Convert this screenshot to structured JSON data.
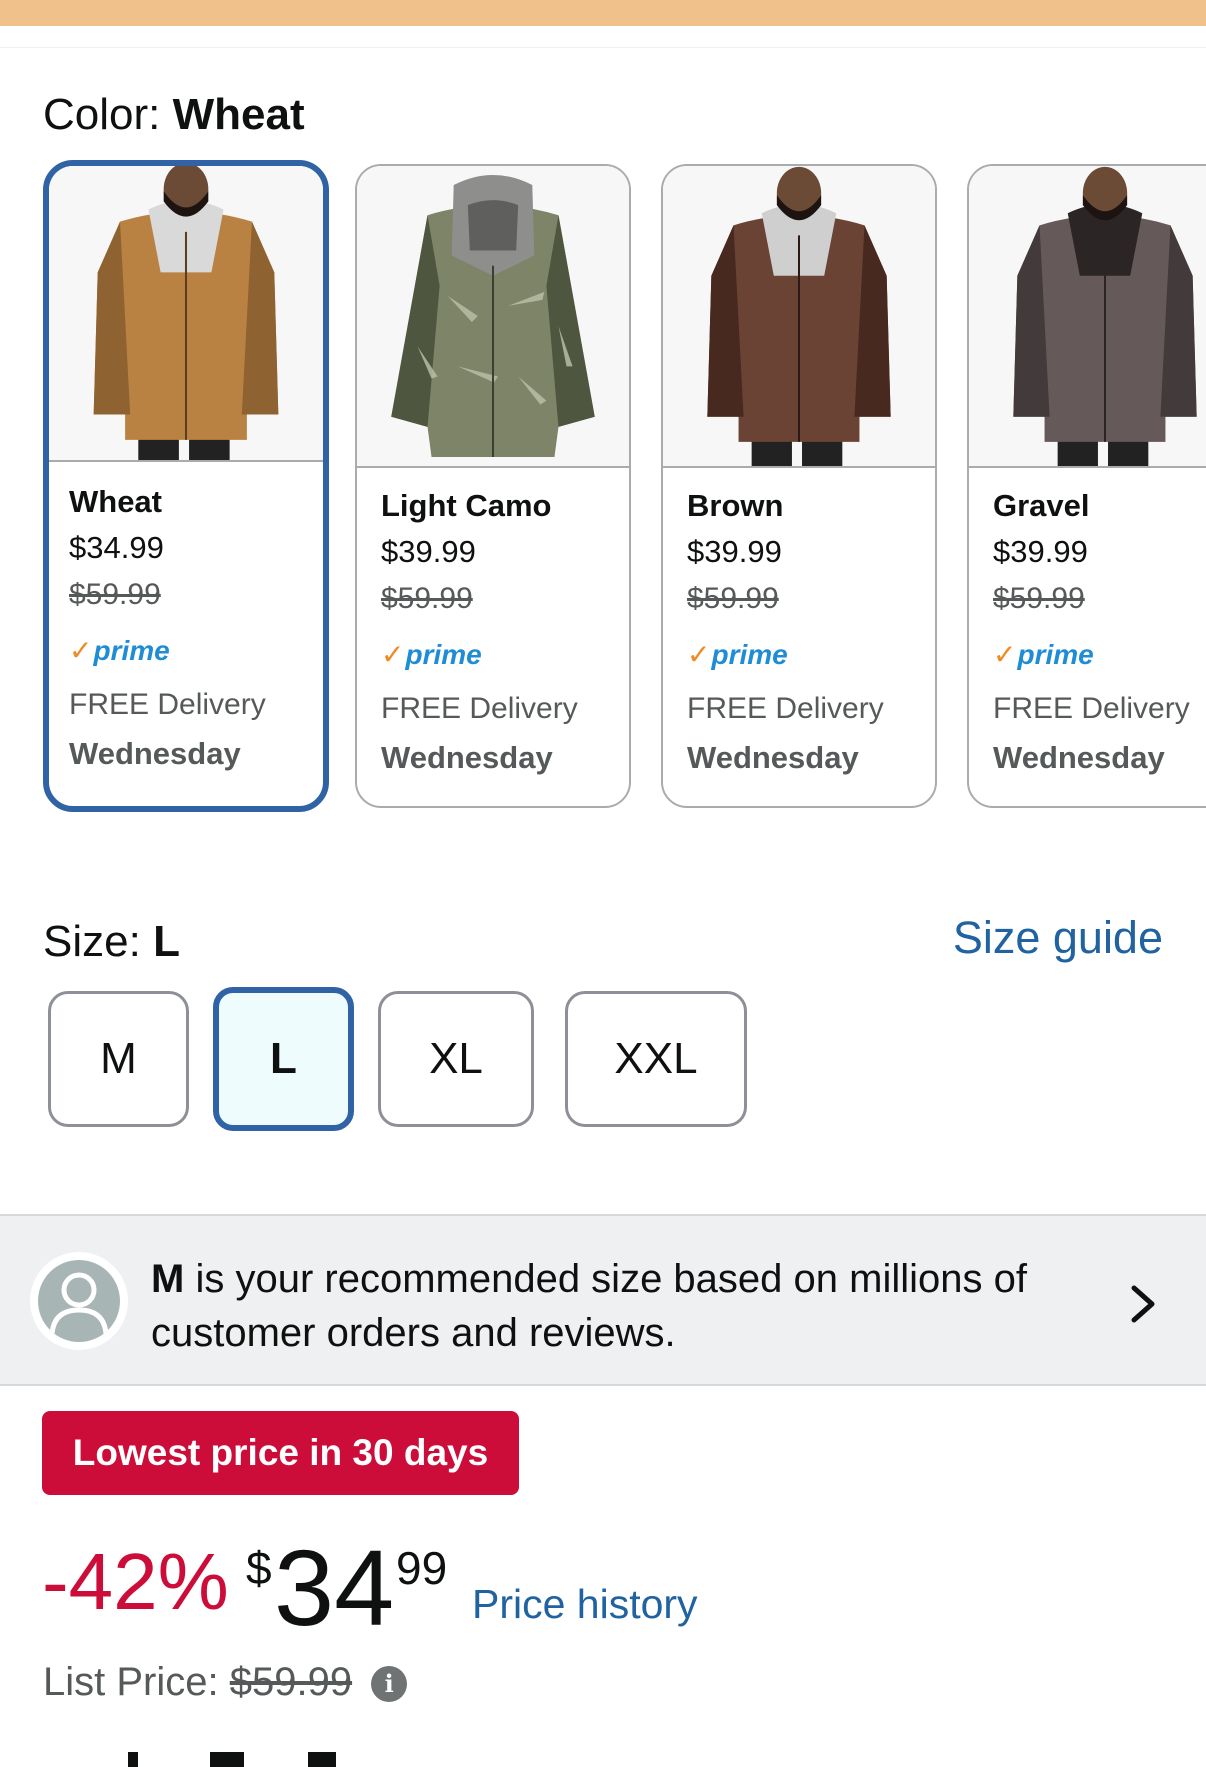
{
  "color_section": {
    "label": "Color:",
    "selected": "Wheat",
    "options": [
      {
        "name": "Wheat",
        "price": "$34.99",
        "list_price": "$59.99",
        "prime": "prime",
        "delivery": "FREE Delivery",
        "day": "Wednesday",
        "jacket_color": "#b98243",
        "shade_color": "#8f6231"
      },
      {
        "name": "Light Camo",
        "price": "$39.99",
        "list_price": "$59.99",
        "prime": "prime",
        "delivery": "FREE Delivery",
        "day": "Wednesday",
        "jacket_color": "#7d8468",
        "shade_color": "#4f5640"
      },
      {
        "name": "Brown",
        "price": "$39.99",
        "list_price": "$59.99",
        "prime": "prime",
        "delivery": "FREE Delivery",
        "day": "Wednesday",
        "jacket_color": "#6a4335",
        "shade_color": "#47291f"
      },
      {
        "name": "Gravel",
        "price": "$39.99",
        "list_price": "$59.99",
        "prime": "prime",
        "delivery": "FREE Delivery",
        "day": "Wednesday",
        "jacket_color": "#65595a",
        "shade_color": "#433a3b"
      }
    ]
  },
  "size_section": {
    "label": "Size:",
    "selected": "L",
    "guide_link": "Size guide",
    "options": [
      "M",
      "L",
      "XL",
      "XXL"
    ]
  },
  "recommendation": {
    "size": "M",
    "text": "is your recommended size based on millions of customer orders and reviews."
  },
  "deal_badge": "Lowest price in 30 days",
  "price": {
    "discount": "-42%",
    "currency": "$",
    "whole": "34",
    "fraction": "99",
    "history_link": "Price history",
    "list_label": "List Price:",
    "list_value": "$59.99",
    "info_icon": "i"
  },
  "colors": {
    "selected_border": "#2f63a6",
    "link": "#2162a1",
    "deal_red": "#cc0c39",
    "prime_blue": "#1f8dd6",
    "prime_check": "#f08a24"
  }
}
